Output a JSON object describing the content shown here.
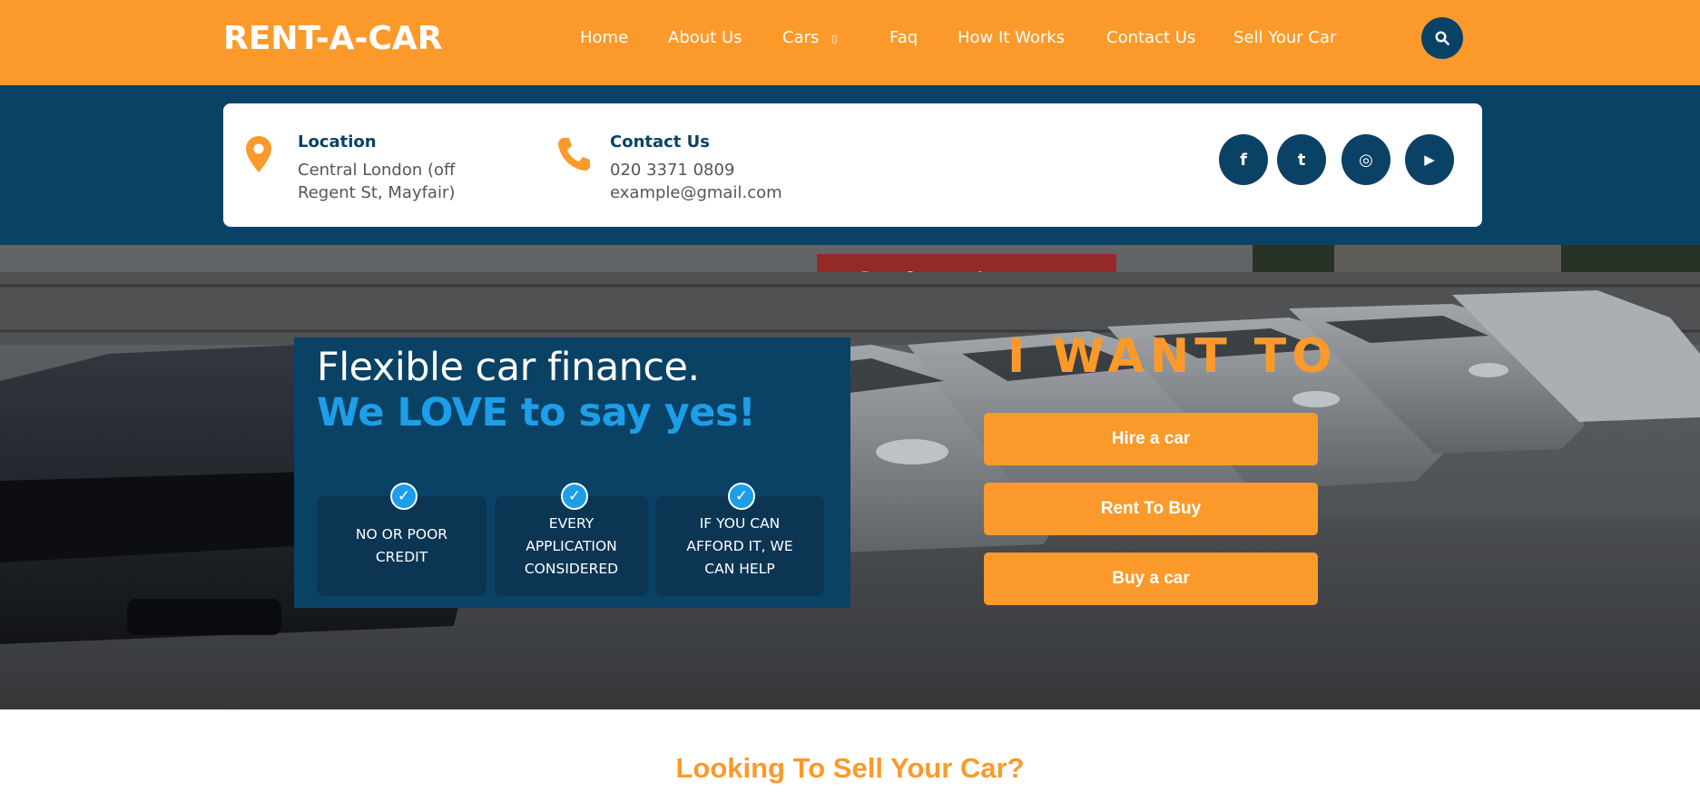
{
  "header": {
    "logo": "RENT-A-CAR",
    "nav": [
      {
        "label": "Home"
      },
      {
        "label": "About Us"
      },
      {
        "label": "Cars",
        "caret": "▯"
      },
      {
        "label": "Faq"
      },
      {
        "label": "How It Works"
      },
      {
        "label": "Contact Us"
      },
      {
        "label": "Sell Your Car"
      }
    ],
    "search_icon": "search-icon"
  },
  "info": {
    "location": {
      "title": "Location",
      "line1": "Central London (off",
      "line2": "Regent St, Mayfair)",
      "icon": "map-pin-icon"
    },
    "contact": {
      "title": "Contact Us",
      "phone": "020 3371 0809",
      "email": "example@gmail.com",
      "icon": "phone-icon"
    },
    "social": [
      {
        "name": "facebook-icon",
        "glyph": "f"
      },
      {
        "name": "twitter-icon",
        "glyph": "t"
      },
      {
        "name": "instagram-icon",
        "glyph": "◎"
      },
      {
        "name": "youtube-icon",
        "glyph": "▶"
      }
    ]
  },
  "hero": {
    "title": "Flexible car finance.",
    "subtitle": "We LOVE to say yes!",
    "features": [
      {
        "text": "NO OR POOR CREDIT"
      },
      {
        "text": "EVERY APPLICATION CONSIDERED"
      },
      {
        "text": "IF YOU CAN AFFORD IT, WE CAN HELP"
      }
    ],
    "sign_text": "Steak was just",
    "want_title": "I WANT TO",
    "buttons": [
      {
        "label": "Hire a car"
      },
      {
        "label": "Rent To Buy"
      },
      {
        "label": "Buy a car"
      }
    ]
  },
  "sell": {
    "heading": "Looking To Sell Your Car?"
  },
  "colors": {
    "orange": "#fb9a2b",
    "navy": "#0a4266",
    "blue": "#1e9ee8"
  }
}
